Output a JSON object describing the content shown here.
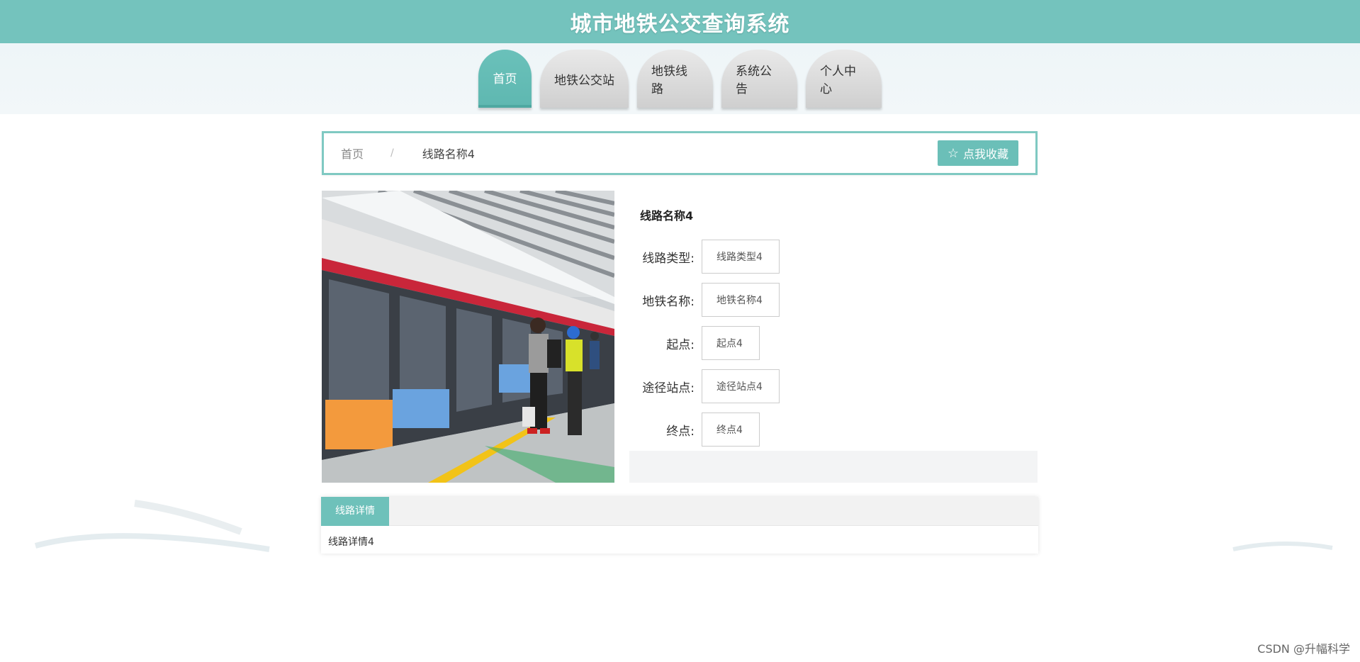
{
  "header": {
    "title": "城市地铁公交查询系统"
  },
  "nav": {
    "items": [
      {
        "label": "首页",
        "active": true
      },
      {
        "label": "地铁公交站",
        "active": false
      },
      {
        "label": "地铁线路",
        "active": false
      },
      {
        "label": "系统公告",
        "active": false
      },
      {
        "label": "个人中心",
        "active": false
      }
    ]
  },
  "breadcrumb": {
    "home": "首页",
    "separator": "/",
    "current": "线路名称4",
    "favorite_button": "点我收藏"
  },
  "detail": {
    "title": "线路名称4",
    "fields": [
      {
        "label": "线路类型:",
        "value": "线路类型4"
      },
      {
        "label": "地铁名称:",
        "value": "地铁名称4"
      },
      {
        "label": "起点:",
        "value": "起点4"
      },
      {
        "label": "途径站点:",
        "value": "途径站点4"
      },
      {
        "label": "终点:",
        "value": "终点4"
      }
    ]
  },
  "tabs": {
    "active_label": "线路详情",
    "content": "线路详情4"
  },
  "watermark": "CSDN @升幅科学",
  "colors": {
    "accent": "#74c3bd",
    "accent_dark": "#5fb8b1"
  }
}
